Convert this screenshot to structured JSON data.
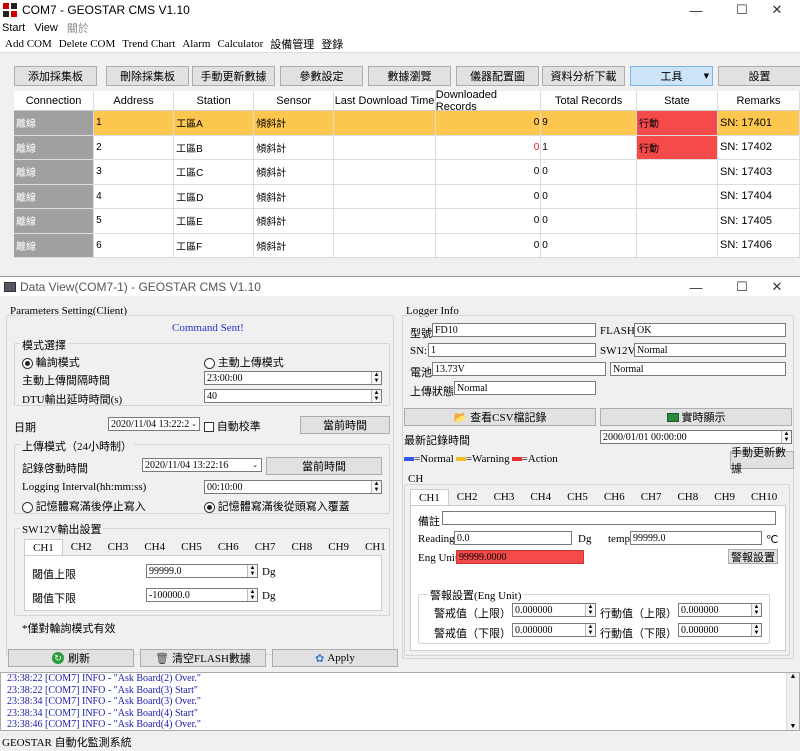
{
  "main_window": {
    "title": "COM7 - GEOSTAR CMS V1.10",
    "menu": [
      "Start",
      "View",
      "關於"
    ],
    "submenu": [
      "Add COM",
      "Delete COM",
      "Trend Chart",
      "Alarm",
      "Calculator",
      "設備管理",
      "登錄"
    ],
    "toolbar": [
      "添加採集板",
      "刪除採集板",
      "手動更新數據",
      "參數設定",
      "數據瀏覽",
      "儀器配置圖",
      "資料分析下載",
      "工具",
      "設置"
    ],
    "columns": [
      "Connection",
      "Address",
      "Station",
      "Sensor",
      "Last Download Time",
      "Downloaded Records",
      "Total Records",
      "State",
      "Remarks"
    ],
    "rows": [
      {
        "conn": "離線",
        "addr": "1",
        "station": "工區A",
        "sensor": "傾斜計",
        "last": "",
        "downloaded": "0",
        "total": "9",
        "state": "行動",
        "remarks": "SN: 17401"
      },
      {
        "conn": "離線",
        "addr": "2",
        "station": "工區B",
        "sensor": "傾斜計",
        "last": "",
        "downloaded": "0",
        "total": "1",
        "state": "行動",
        "remarks": "SN: 17402"
      },
      {
        "conn": "離線",
        "addr": "3",
        "station": "工區C",
        "sensor": "傾斜計",
        "last": "",
        "downloaded": "0",
        "total": "0",
        "state": "",
        "remarks": "SN: 17403"
      },
      {
        "conn": "離線",
        "addr": "4",
        "station": "工區D",
        "sensor": "傾斜計",
        "last": "",
        "downloaded": "0",
        "total": "0",
        "state": "",
        "remarks": "SN: 17404"
      },
      {
        "conn": "離線",
        "addr": "5",
        "station": "工區E",
        "sensor": "傾斜計",
        "last": "",
        "downloaded": "0",
        "total": "0",
        "state": "",
        "remarks": "SN: 17405"
      },
      {
        "conn": "離線",
        "addr": "6",
        "station": "工區F",
        "sensor": "傾斜計",
        "last": "",
        "downloaded": "0",
        "total": "0",
        "state": "",
        "remarks": "SN: 17406"
      }
    ]
  },
  "data_view": {
    "title": "Data View(COM7-1) - GEOSTAR CMS V1.10",
    "params_label": "Parameters Setting(Client)",
    "command_sent": "Command Sent!",
    "mode_label": "模式選擇",
    "mode_poll": "輪詢模式",
    "mode_upload": "主動上傳模式",
    "upload_interval_label": "主動上傳間隔時間",
    "upload_interval": "23:00:00",
    "dtu_delay_label": "DTU輸出延時時間(s)",
    "dtu_delay": "40",
    "date_label": "日期",
    "date_value": "2020/11/04 13:22:2",
    "auto_calib": "自動校準",
    "current_time_btn": "當前時間",
    "upload_mode_label": "上傳模式（24小時制）",
    "record_start_label": "記錄啓動時間",
    "record_start": "2020/11/04 13:22:16",
    "current_time_btn2": "當前時間",
    "logging_interval_label": "Logging Interval(hh:mm:ss)",
    "logging_interval": "00:10:00",
    "mem_stop": "記憶體寫滿後停止寫入",
    "mem_overwrite": "記憶體寫滿後從頭寫入覆蓋",
    "sw12v_label": "SW12V輸出設置",
    "ch_tabs": [
      "CH1",
      "CH2",
      "CH3",
      "CH4",
      "CH5",
      "CH6",
      "CH7",
      "CH8",
      "CH9",
      "CH1"
    ],
    "upper_label": "閾值上限",
    "upper_value": "99999.0",
    "lower_label": "閾值下限",
    "lower_value": "-100000.0",
    "unit_dg": "Dg",
    "poll_note": "*僅對輪詢模式有效",
    "refresh_btn": "刷新",
    "clear_flash_btn": "清空FLASH數據",
    "apply_btn": "Apply",
    "logger_info_label": "Logger Info",
    "model_label": "型號",
    "model_value": "FD10",
    "flash_label": "FLASH:",
    "flash_value": "OK",
    "sn_label": "SN:",
    "sn_value": "1",
    "sw12v_status_label": "SW12V:",
    "sw12v_status_value": "Normal",
    "battery_label": "電池",
    "battery_value": "13.73V",
    "battery_status": "Normal",
    "upload_status_label": "上傳狀態",
    "upload_status_value": "Normal",
    "csv_btn": "查看CSV檔記錄",
    "realtime_btn": "實時顯示",
    "latest_record_label": "最新記錄時間",
    "latest_record_value": "2000/01/01 00:00:00",
    "legend_normal": "=Normal",
    "legend_warning": "=Warning",
    "legend_action": "=Action",
    "manual_update_btn": "手動更新數據",
    "ch_label": "CH",
    "ch_tabs2": [
      "CH1",
      "CH2",
      "CH3",
      "CH4",
      "CH5",
      "CH6",
      "CH7",
      "CH8",
      "CH9",
      "CH10"
    ],
    "remark_label": "備註",
    "reading_label": "Reading",
    "reading_value": "0.0",
    "temp_label": "temp",
    "temp_value": "99999.0",
    "temp_unit": "℃",
    "eng_unit_label": "Eng Unit",
    "eng_unit_value": "99999.0000",
    "alarm_set_btn": "警報設置",
    "alarm_group_label": "警報設置(Eng Unit)",
    "warn_upper_label": "警戒值（上限）",
    "warn_upper": "0.000000",
    "act_upper_label": "行動值（上限）",
    "act_upper": "0.000000",
    "warn_lower_label": "警戒值（下限）",
    "warn_lower": "0.000000",
    "act_lower_label": "行動值（下限）",
    "act_lower": "0.000000"
  },
  "log_lines": [
    "23:38:22 [COM7] INFO - \"Ask Board(2) Over.\"",
    "23:38:22 [COM7] INFO - \"Ask Board(3) Start\"",
    "23:38:34 [COM7] INFO - \"Ask Board(3) Over.\"",
    "23:38:34 [COM7] INFO - \"Ask Board(4) Start\"",
    "23:38:46 [COM7] INFO - \"Ask Board(4) Over.\""
  ],
  "status_bar": "GEOSTAR 自動化監測系統",
  "colors": {
    "highlight_row": "#fcc64f",
    "action": "#f54a4a",
    "normal_blue": "#3355ee",
    "warning_yellow": "#f0c020",
    "action_red": "#e83030"
  }
}
